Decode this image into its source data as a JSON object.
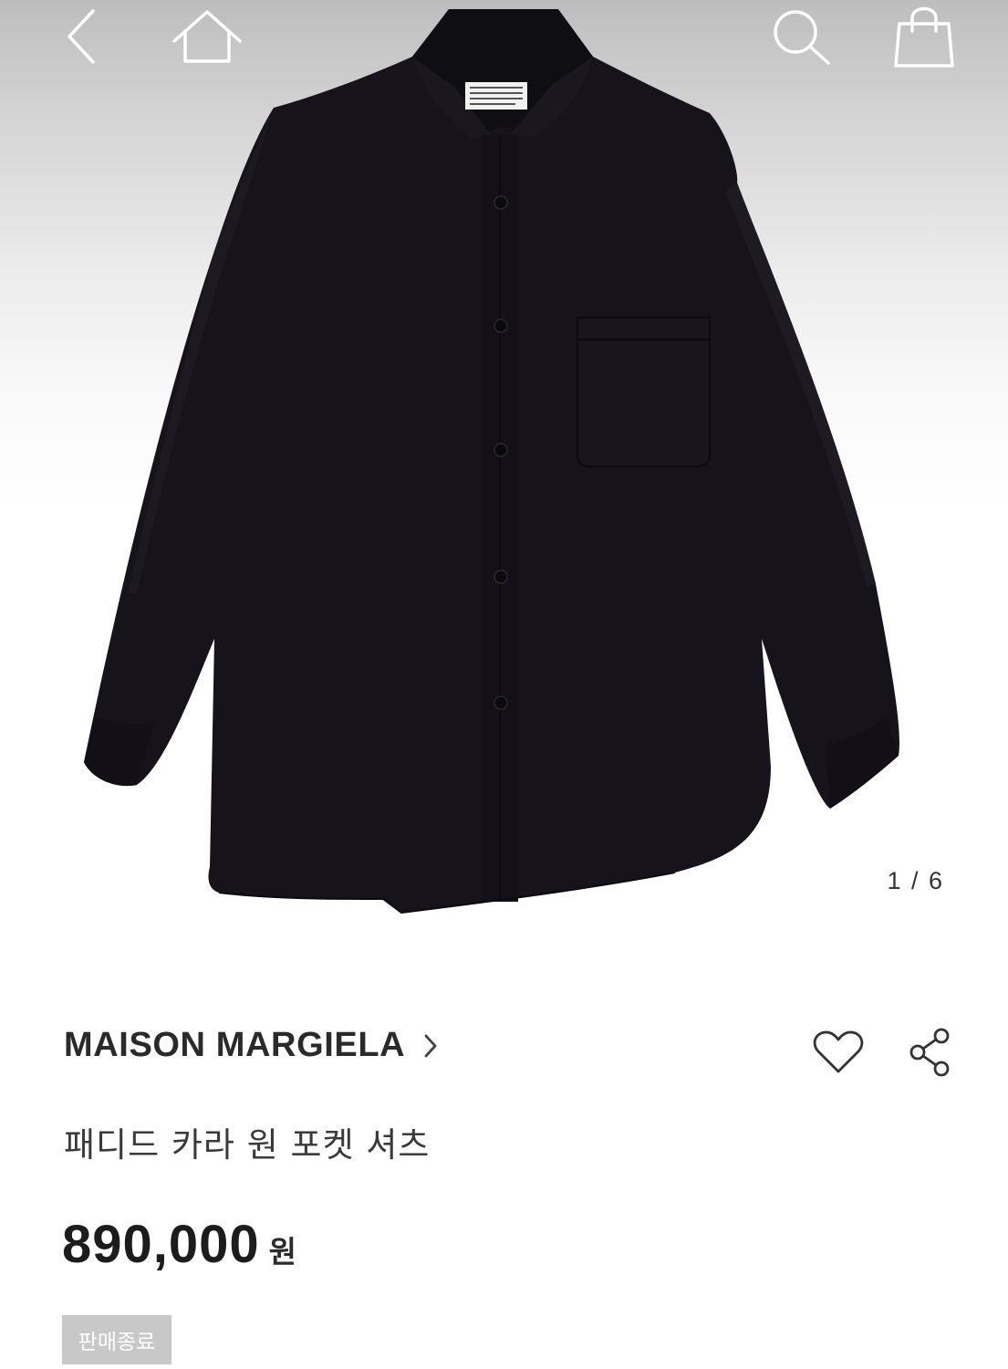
{
  "gallery": {
    "page_current": "1",
    "page_total": "6",
    "page_indicator": "1 / 6",
    "image_subject": "black long-sleeve shirt with one chest pocket"
  },
  "top_bar": {
    "back_icon": "chevron-left-icon",
    "home_icon": "home-icon",
    "search_icon": "search-icon",
    "cart_icon": "shopping-bag-icon"
  },
  "product": {
    "brand": "MAISON MARGIELA",
    "name": "패디드 카라 원 포켓 셔츠",
    "price": "890,000",
    "currency": "원",
    "status": "판매종료"
  },
  "actions": {
    "wish_icon": "heart-icon",
    "share_icon": "share-icon"
  },
  "colors": {
    "text_primary": "#1c1c1c",
    "badge_bg": "#c8c8c8",
    "shirt": "#16141a"
  }
}
